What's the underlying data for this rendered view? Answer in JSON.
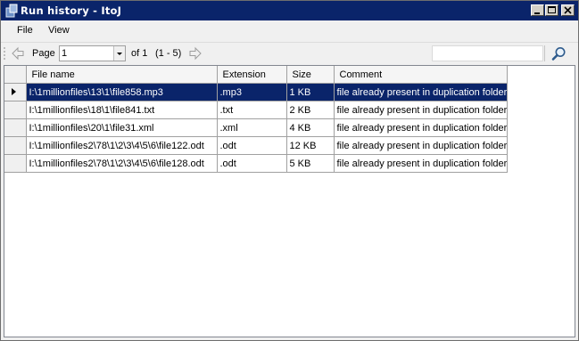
{
  "window": {
    "title": "Run history - ItoJ"
  },
  "menu": {
    "items": [
      "File",
      "View"
    ]
  },
  "toolbar": {
    "page_label": "Page",
    "page_value": "1",
    "of_label": "of 1",
    "range_label": "(1 - 5)",
    "search_value": ""
  },
  "grid": {
    "columns": [
      "File name",
      "Extension",
      "Size",
      "Comment"
    ],
    "rows": [
      [
        "I:\\1millionfiles\\13\\1\\file858.mp3",
        ".mp3",
        "1 KB",
        "file already present in duplication folder"
      ],
      [
        "I:\\1millionfiles\\18\\1\\file841.txt",
        ".txt",
        "2 KB",
        "file already present in duplication folder"
      ],
      [
        "I:\\1millionfiles\\20\\1\\file31.xml",
        ".xml",
        "4 KB",
        "file already present in duplication folder"
      ],
      [
        "I:\\1millionfiles2\\78\\1\\2\\3\\4\\5\\6\\file122.odt",
        ".odt",
        "12 KB",
        "file already present in duplication folder"
      ],
      [
        "I:\\1millionfiles2\\78\\1\\2\\3\\4\\5\\6\\file128.odt",
        ".odt",
        "5 KB",
        "file already present in duplication folder"
      ]
    ],
    "selected_row": 0
  },
  "colors": {
    "titlebar": "#0a246a",
    "selection": "#0a246a"
  }
}
